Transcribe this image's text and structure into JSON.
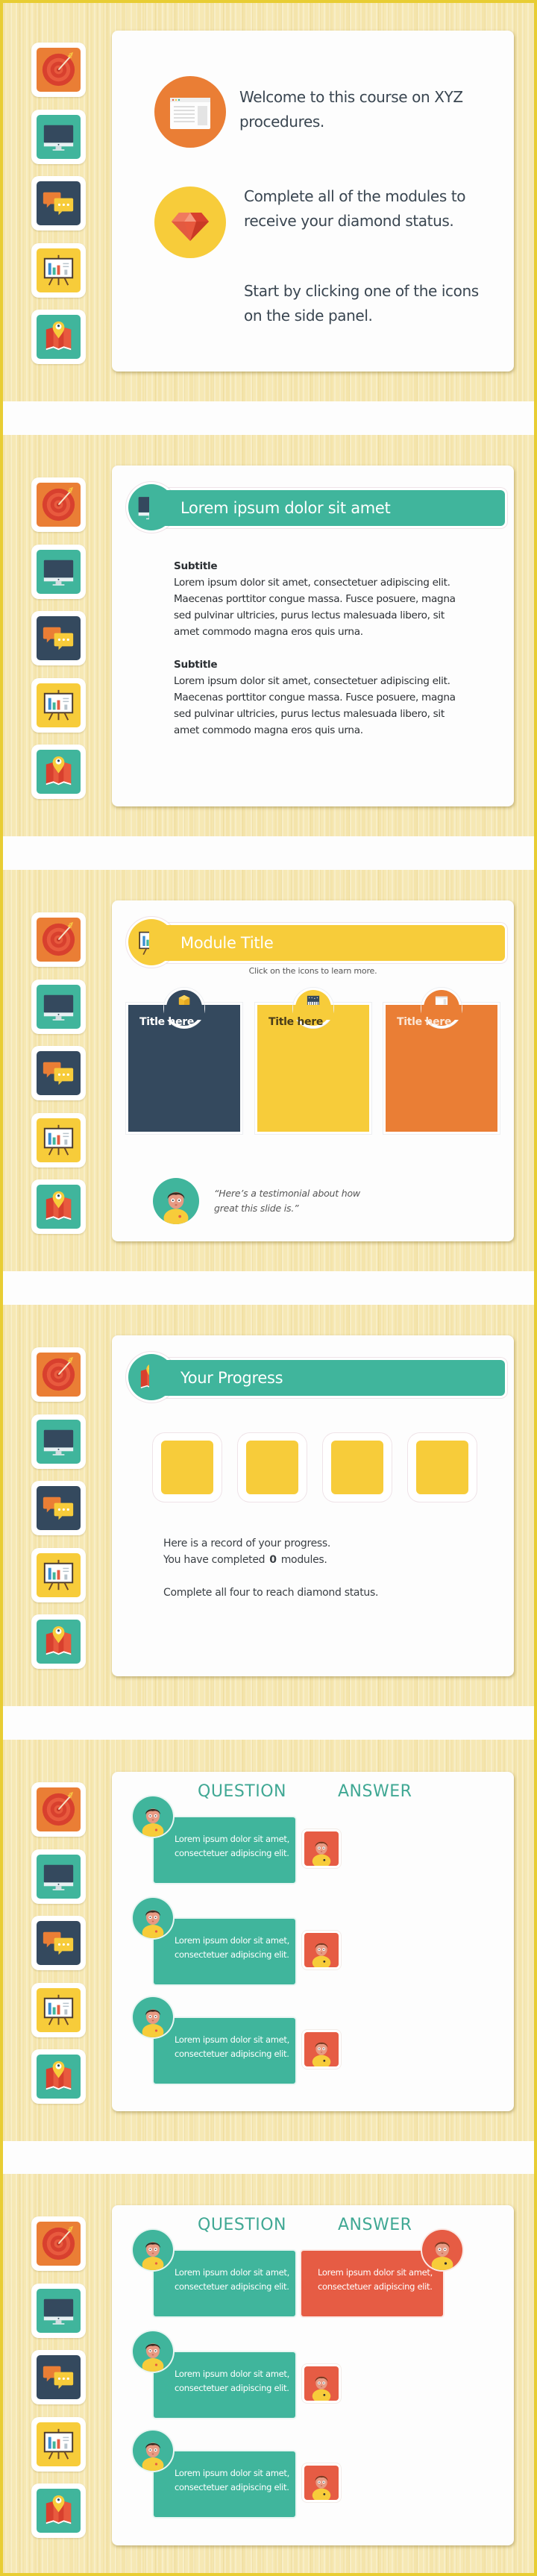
{
  "colors": {
    "teal": "#40b59c",
    "orange": "#ea7e35",
    "navy": "#34495e",
    "yellow": "#f7cc3a",
    "red": "#e65c44",
    "border": "#e8cd33",
    "wood": "#f6e8b4"
  },
  "side_panel": {
    "items": [
      {
        "icon": "target-icon",
        "color": "orange"
      },
      {
        "icon": "monitor-icon",
        "color": "teal"
      },
      {
        "icon": "chat-bubbles-icon",
        "color": "navy"
      },
      {
        "icon": "presentation-chart-icon",
        "color": "yellow"
      },
      {
        "icon": "map-pin-icon",
        "color": "teal"
      }
    ]
  },
  "slides": {
    "welcome": {
      "line1": "Welcome to this course on XYZ procedures.",
      "line2": "Complete all of the modules to receive your diamond status.",
      "line3": "Start by clicking one of the icons on the side panel.",
      "icon1": "browser-window-icon",
      "icon2": "diamond-icon"
    },
    "content": {
      "title": "Lorem ipsum dolor sit amet",
      "sections": [
        {
          "subtitle": "Subtitle",
          "body": "Lorem ipsum dolor sit amet, consectetuer adipiscing elit. Maecenas porttitor congue massa. Fusce posuere, magna sed pulvinar ultricies, purus lectus malesuada libero, sit amet commodo magna eros quis urna."
        },
        {
          "subtitle": "Subtitle",
          "body": "Lorem ipsum dolor sit amet, consectetuer adipiscing elit. Maecenas porttitor congue massa. Fusce posuere, magna sed pulvinar ultricies, purus lectus malesuada libero, sit amet commodo magna eros quis urna."
        }
      ]
    },
    "module": {
      "title": "Module Title",
      "instruction": "Click on the icons to learn more.",
      "cards": [
        {
          "title": "Title here",
          "icon": "box-icon",
          "color": "navy"
        },
        {
          "title": "Title here",
          "icon": "keyboard-synth-icon",
          "color": "yellow"
        },
        {
          "title": "Title here",
          "icon": "browser-window-icon",
          "color": "orange"
        }
      ],
      "testimonial": "“Here’s a testimonial about how great this slide is.”"
    },
    "progress": {
      "title": "Your Progress",
      "boxes_total": 4,
      "completed": "0",
      "line1": "Here is a record of your progress.",
      "line2_prefix": "You have completed",
      "line2_suffix": "modules.",
      "line3": "Complete all four to reach diamond status."
    },
    "qa1": {
      "question_header": "QUESTION",
      "answer_header": "ANSWER",
      "rows": [
        {
          "question": "Lorem ipsum dolor sit amet, consectetuer adipiscing elit.",
          "answer": null
        },
        {
          "question": "Lorem ipsum dolor sit amet, consectetuer adipiscing elit.",
          "answer": null
        },
        {
          "question": "Lorem ipsum dolor sit amet, consectetuer adipiscing elit.",
          "answer": null
        }
      ]
    },
    "qa2": {
      "question_header": "QUESTION",
      "answer_header": "ANSWER",
      "rows": [
        {
          "question": "Lorem ipsum dolor sit amet, consectetuer adipiscing elit.",
          "answer": "Lorem ipsum dolor sit amet, consectetuer adipiscing elit."
        },
        {
          "question": "Lorem ipsum dolor sit amet, consectetuer adipiscing elit.",
          "answer": null
        },
        {
          "question": "Lorem ipsum dolor sit amet, consectetuer adipiscing elit.",
          "answer": null
        }
      ]
    }
  }
}
